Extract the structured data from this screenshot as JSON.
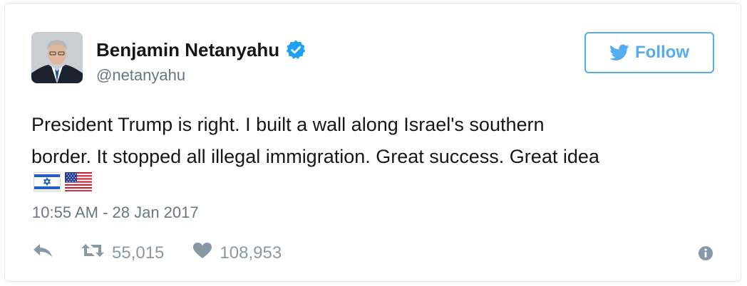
{
  "author": {
    "display_name": "Benjamin Netanyahu",
    "handle": "@netanyahu",
    "verified": true,
    "avatar_icon": "profile-photo"
  },
  "follow_button": {
    "label": "Follow",
    "icon": "twitter-bird-icon"
  },
  "tweet": {
    "line1": "President Trump is right. I built a wall along Israel's southern",
    "line2": "border. It stopped all illegal immigration. Great success. Great idea",
    "emojis": [
      "israel-flag",
      "usa-flag"
    ],
    "timestamp": "10:55 AM - 28 Jan 2017"
  },
  "actions": {
    "reply_icon": "reply-icon",
    "retweet_icon": "retweet-icon",
    "retweet_count": "55,015",
    "like_icon": "heart-icon",
    "like_count": "108,953",
    "info_icon": "info-icon"
  },
  "colors": {
    "twitter_blue": "#55acee",
    "text_primary": "#14171a",
    "text_secondary": "#657786",
    "action_gray": "#8899a6",
    "border": "#e1e8ed"
  }
}
